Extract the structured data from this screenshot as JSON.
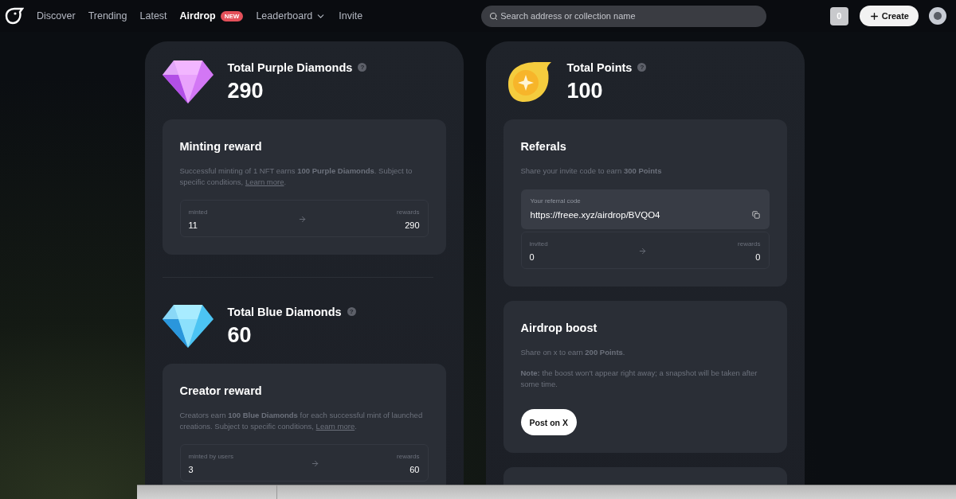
{
  "nav": {
    "links": [
      {
        "label": "Discover",
        "selected": false
      },
      {
        "label": "Trending",
        "selected": false
      },
      {
        "label": "Latest",
        "selected": false
      },
      {
        "label": "Airdrop",
        "selected": true,
        "badge": "NEW"
      },
      {
        "label": "Leaderboard",
        "selected": false,
        "dropdown": true
      },
      {
        "label": "Invite",
        "selected": false
      }
    ]
  },
  "search": {
    "placeholder": "Search address or collection name"
  },
  "counter": "0",
  "create_button": "Create",
  "columns": [
    [
      {
        "kind": "total",
        "title": "Total Purple Diamonds",
        "help": "?",
        "value": "290"
      },
      {
        "kind": "reward",
        "title": "Minting reward",
        "description": "Successful minting of 1 NFT earns **100 Purple Diamonds**. Subject to specific conditions, ",
        "link": "Learn more",
        "after": ".",
        "stats": {
          "left_label": "minted",
          "left_value": "11",
          "right_label": "rewards",
          "right_value": "290"
        }
      },
      {
        "kind": "divider"
      },
      {
        "kind": "total",
        "title": "Total Blue Diamonds",
        "help": "?",
        "value": "60"
      },
      {
        "kind": "reward",
        "title": "Creator reward",
        "description": "Creators earn **100 Blue Diamonds** for each successful mint of launched creations. Subject to specific conditions, ",
        "link": "Learn more",
        "after": ".",
        "stats": {
          "left_label": "minted by users",
          "left_value": "3",
          "right_label": "rewards",
          "right_value": "60"
        }
      }
    ],
    [
      {
        "kind": "total",
        "title": "Total Points",
        "help": "?",
        "value": "100"
      },
      {
        "kind": "referral",
        "title": "Referals",
        "description": "Share your invite code to earn **300 Points**",
        "code_label": "Your referral code",
        "code": "https://freee.xyz/airdrop/BVQO4",
        "stats": {
          "left_label": "invited",
          "left_value": "0",
          "right_label": "rewards",
          "right_value": "0"
        }
      },
      {
        "kind": "boost",
        "title": "Airdrop boost",
        "description": "Share on x to earn **200 Points**.",
        "note": "**Note:** the boost won't appear right away; a snapshot will be taken after some time.",
        "button": "Post on X"
      },
      {
        "kind": "empty"
      }
    ]
  ]
}
